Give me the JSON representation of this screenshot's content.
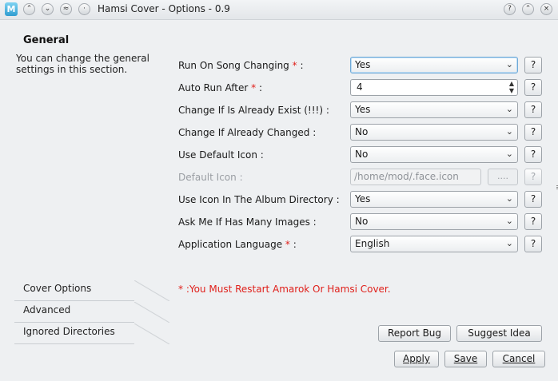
{
  "window": {
    "title": "Hamsi Cover - Options - 0.9",
    "app_icon": "M",
    "buttons": {
      "shade_up": "^",
      "shade_down": "v",
      "close_small": "≈",
      "sticky": "·",
      "help": "?",
      "maximize": "^",
      "close": "×"
    }
  },
  "general": {
    "heading": "General",
    "description": "You can change the general settings in this section."
  },
  "tabs": [
    "Cover Options",
    "Advanced",
    "Ignored Directories"
  ],
  "fields": [
    {
      "label": "Run On Song Changing",
      "required": true,
      "colon": " :",
      "type": "combo",
      "value": "Yes"
    },
    {
      "label": "Auto Run After",
      "required": true,
      "colon": " :",
      "type": "spin",
      "value": "4"
    },
    {
      "label": "Change If Is Already Exist (!!!)",
      "required": false,
      "colon": " :",
      "type": "combo",
      "value": "Yes"
    },
    {
      "label": "Change If Already Changed",
      "required": false,
      "colon": " :",
      "type": "combo",
      "value": "No"
    },
    {
      "label": "Use Default Icon",
      "required": false,
      "colon": " :",
      "type": "combo",
      "value": "No"
    },
    {
      "label": "Default Icon",
      "required": false,
      "colon": " :",
      "type": "path",
      "value": "/home/mod/.face.icon",
      "browse": "...."
    },
    {
      "label": "Use Icon In The Album Directory",
      "required": false,
      "colon": " :",
      "type": "combo",
      "value": "Yes"
    },
    {
      "label": "Ask Me If Has Many Images",
      "required": false,
      "colon": " :",
      "type": "combo",
      "value": "No"
    },
    {
      "label": "Application Language",
      "required": true,
      "colon": " :",
      "type": "combo",
      "value": "English"
    }
  ],
  "required_mark": "*",
  "help_label": "?",
  "restart_note": "* :You Must Restart Amarok Or Hamsi Cover.",
  "actions": {
    "report_bug": "Report Bug",
    "suggest_idea": "Suggest Idea",
    "apply": "Apply",
    "save": "Save",
    "cancel": "Cancel"
  },
  "colors": {
    "required": "#e0201b",
    "focus": "#6fa9d7",
    "background": "#eef0f2"
  }
}
